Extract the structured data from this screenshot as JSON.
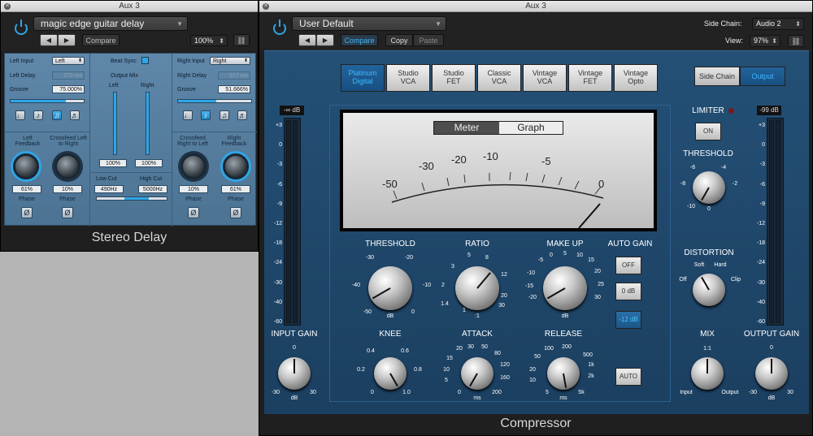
{
  "sd_window": {
    "title": "Aux 3",
    "preset": "magic edge guitar delay",
    "compare": "Compare",
    "zoom": "100%",
    "footer": "Stereo Delay"
  },
  "delay": {
    "left_input_label": "Left Input",
    "left_input": "Left",
    "left_delay_label": "Left Delay",
    "left_delay": "375 ms",
    "groove_label": "Groove",
    "left_groove": "75.000%",
    "left_groove_level": 0.75,
    "beat_sync": "Beat Sync",
    "output_mix": "Output Mix",
    "left": "Left",
    "right": "Right",
    "out_left": "100%",
    "out_right": "100%",
    "out_left_level": 1.0,
    "out_right_level": 1.0,
    "low_cut": "Low Cut",
    "high_cut": "High Cut",
    "low_cut_val": "490Hz",
    "high_cut_val": "5000Hz",
    "right_input_label": "Right Input",
    "right_input": "Right",
    "right_delay_label": "Right Delay",
    "right_delay": "517 ms",
    "right_groove": "51.666%",
    "right_groove_level": 0.52,
    "left_feedback_label": "Left Feedback",
    "crossfeed_lr_label": "Crossfeed Left to Right",
    "crossfeed_rl_label": "Crossfeed Right to Left",
    "right_feedback_label": "Right Feedback",
    "left_feedback": "61%",
    "crossfeed_lr": "10%",
    "crossfeed_rl": "10%",
    "right_feedback": "61%",
    "phase": "Phase",
    "phase_glyph": "Ø"
  },
  "cp_window": {
    "title": "Aux 3",
    "preset": "User Default",
    "compare": "Compare",
    "copy": "Copy",
    "paste": "Paste",
    "side_chain_label": "Side Chain:",
    "side_chain": "Audio 2",
    "view_label": "View:",
    "view": "97%",
    "footer": "Compressor"
  },
  "comp": {
    "models": [
      {
        "l1": "Platinum",
        "l2": "Digital"
      },
      {
        "l1": "Studio",
        "l2": "VCA"
      },
      {
        "l1": "Studio",
        "l2": "FET"
      },
      {
        "l1": "Classic",
        "l2": "VCA"
      },
      {
        "l1": "Vintage",
        "l2": "VCA"
      },
      {
        "l1": "Vintage",
        "l2": "FET"
      },
      {
        "l1": "Vintage",
        "l2": "Opto"
      }
    ],
    "side_chain_btn": "Side Chain",
    "output_btn": "Output",
    "meter_tab": "Meter",
    "graph_tab": "Graph",
    "vu": [
      "-50",
      "-30",
      "-20",
      "-10",
      "-5",
      "0"
    ],
    "in_meter_val": "-∞ dB",
    "out_meter_val": "-99 dB",
    "scale": [
      "+3",
      "0",
      "-3",
      "-6",
      "-9",
      "-12",
      "-18",
      "-24",
      "-30",
      "-40",
      "-60"
    ],
    "limiter": "LIMITER",
    "on": "ON",
    "threshold": "THRESHOLD",
    "ratio": "RATIO",
    "makeup": "MAKE UP",
    "auto_gain": "AUTO GAIN",
    "ag_off": "OFF",
    "ag_0": "0 dB",
    "ag_12": "-12 dB",
    "auto": "AUTO",
    "knee": "KNEE",
    "attack": "ATTACK",
    "release": "RELEASE",
    "input_gain": "INPUT GAIN",
    "output_gain": "OUTPUT GAIN",
    "mix": "MIX",
    "distortion": "DISTORTION",
    "db": "dB",
    "ms": "ms",
    "th_scale": [
      "-30",
      "-20",
      "-40",
      "-10",
      "-50",
      "0"
    ],
    "ratio_scale": [
      "5",
      "8",
      "3",
      "12",
      "2",
      "20",
      "1.4",
      "30",
      "1",
      ":1"
    ],
    "mu_scale": [
      "0",
      "5",
      "10",
      "15",
      "-5",
      "20",
      "-10",
      "25",
      "-15",
      "30",
      "-20"
    ],
    "knee_scale": [
      "0.4",
      "0.6",
      "0.2",
      "0.8",
      "0",
      "1.0"
    ],
    "atk_scale": [
      "20",
      "30",
      "50",
      "15",
      "80",
      "10",
      "120",
      "5",
      "160",
      "0",
      "200"
    ],
    "rel_scale": [
      "100",
      "200",
      "50",
      "500",
      "20",
      "1k",
      "10",
      "2k",
      "5",
      "5k"
    ],
    "ing_scale": [
      "0",
      "-30",
      "30"
    ],
    "lim_th_scale": [
      "-6",
      "-4",
      "-8",
      "-2",
      "-10",
      "0"
    ],
    "dist": [
      "Soft",
      "Hard",
      "Off",
      "Clip"
    ],
    "mix_scale": [
      "1:1",
      "Input",
      "Output"
    ]
  }
}
